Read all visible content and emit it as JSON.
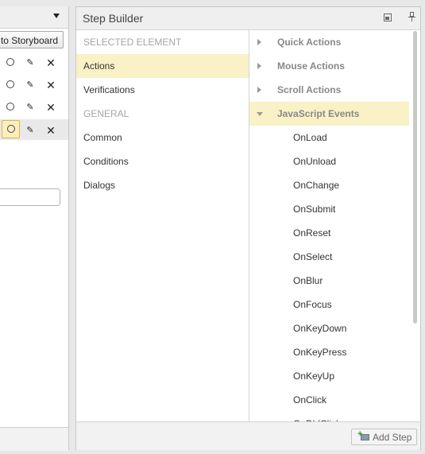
{
  "left_panel": {
    "storyboard_button_label": "to Storyboard",
    "row_icons": {
      "eye": "eye-icon",
      "edit": "pencil-icon",
      "delete": "close-icon"
    },
    "delete_glyph": "✕",
    "edit_glyph": "✎"
  },
  "step_builder": {
    "title": "Step Builder",
    "categories": [
      {
        "label": "SELECTED ELEMENT",
        "type": "heading"
      },
      {
        "label": "Actions",
        "type": "item",
        "selected": true
      },
      {
        "label": "Verifications",
        "type": "item"
      },
      {
        "label": "GENERAL",
        "type": "heading"
      },
      {
        "label": "Common",
        "type": "item"
      },
      {
        "label": "Conditions",
        "type": "item"
      },
      {
        "label": "Dialogs",
        "type": "item"
      }
    ],
    "groups": [
      {
        "label": "Quick Actions",
        "expanded": false
      },
      {
        "label": "Mouse Actions",
        "expanded": false
      },
      {
        "label": "Scroll Actions",
        "expanded": false
      },
      {
        "label": "JavaScript Events",
        "expanded": true
      }
    ],
    "events": [
      "OnLoad",
      "OnUnload",
      "OnChange",
      "OnSubmit",
      "OnReset",
      "OnSelect",
      "OnBlur",
      "OnFocus",
      "OnKeyDown",
      "OnKeyPress",
      "OnKeyUp",
      "OnClick",
      "OnDblClick"
    ],
    "add_step_label": "Add Step",
    "colors": {
      "selection": "#fbf1c7",
      "heading": "#a5a5a5",
      "group": "#888888"
    }
  }
}
